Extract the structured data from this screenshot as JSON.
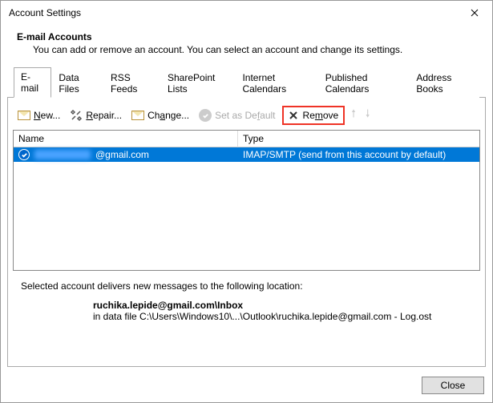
{
  "window_title": "Account Settings",
  "header": {
    "title": "E-mail Accounts",
    "subtitle": "You can add or remove an account. You can select an account and change its settings."
  },
  "tabs": [
    {
      "label": "E-mail",
      "active": true
    },
    {
      "label": "Data Files"
    },
    {
      "label": "RSS Feeds"
    },
    {
      "label": "SharePoint Lists"
    },
    {
      "label": "Internet Calendars"
    },
    {
      "label": "Published Calendars"
    },
    {
      "label": "Address Books"
    }
  ],
  "toolbar": {
    "new_pre": "N",
    "new_label": "ew...",
    "repair_pre": "R",
    "repair_label": "epair...",
    "change_pre": "Ch",
    "change_u": "a",
    "change_post": "nge...",
    "default_pre": "Set as De",
    "default_u": "f",
    "default_post": "ault",
    "remove_pre": "Re",
    "remove_u": "m",
    "remove_post": "ove"
  },
  "table": {
    "columns": {
      "name": "Name",
      "type": "Type"
    },
    "rows": [
      {
        "name_suffix": "@gmail.com",
        "type": "IMAP/SMTP (send from this account by default)",
        "selected": true,
        "default": true
      }
    ]
  },
  "location": {
    "label": "Selected account delivers new messages to the following location:",
    "bold": "ruchika.lepide@gmail.com\\Inbox",
    "data_file": "in data file C:\\Users\\Windows10\\...\\Outlook\\ruchika.lepide@gmail.com - Log.ost"
  },
  "footer": {
    "close": "Close"
  }
}
